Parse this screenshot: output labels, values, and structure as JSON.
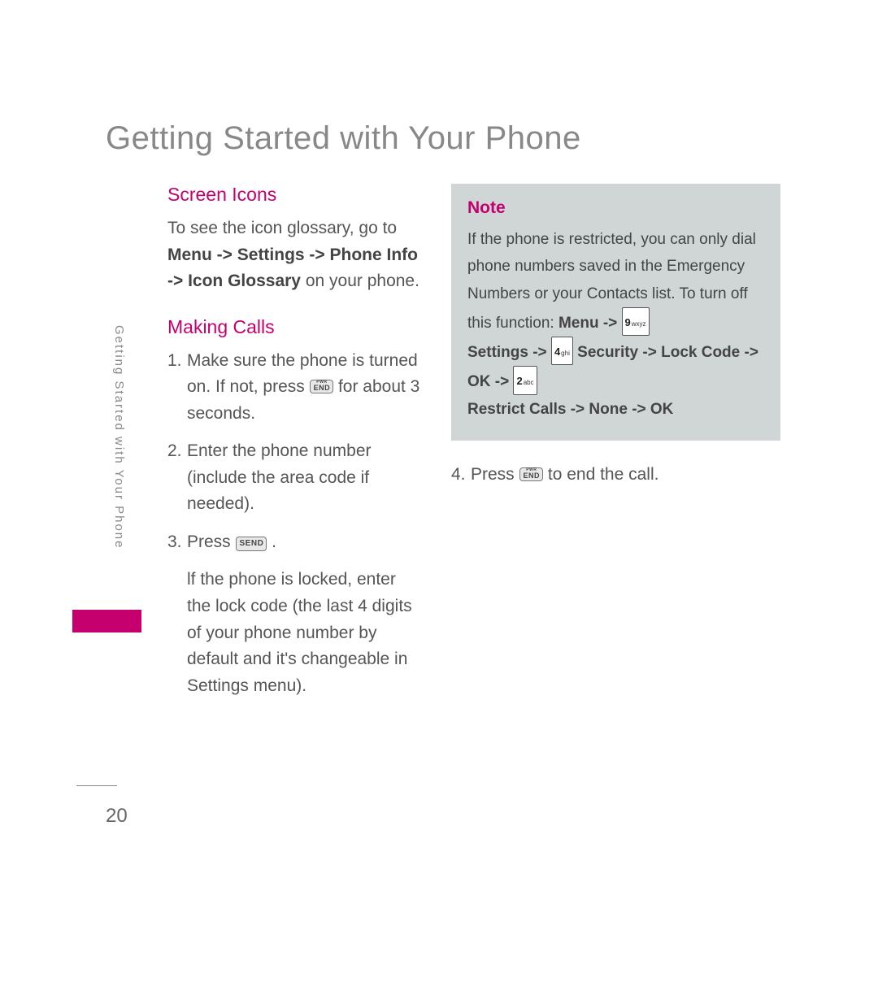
{
  "title": "Getting Started with Your Phone",
  "side_tab": "Getting Started with Your Phone",
  "page_number": "20",
  "left": {
    "screen_icons": {
      "heading": "Screen Icons",
      "line1": "To see the icon glossary, go to ",
      "bold1": "Menu -> Settings -> Phone Info -> Icon Glossary",
      "line2": " on your phone."
    },
    "making_calls": {
      "heading": "Making Calls",
      "items": [
        {
          "num": "1.",
          "pre": "Make sure the phone is turned on. If not, press ",
          "key": "PWR END",
          "post": " for about 3 seconds."
        },
        {
          "num": "2.",
          "text": "Enter the phone number (include the area code if needed)."
        },
        {
          "num": "3.",
          "pre": "Press ",
          "key": "SEND",
          "post": " .",
          "extra": "lf the phone is locked, enter the lock code (the last 4 digits of your phone number by default and it's changeable in Settings menu)."
        }
      ]
    }
  },
  "right": {
    "note": {
      "heading": "Note",
      "line1": "If the phone is restricted, you can only dial phone numbers saved in the Emergency Numbers or your Contacts list. To turn off this function: ",
      "menu_bold": "Menu ->",
      "key9": {
        "big": "9",
        "small": "wxyz"
      },
      "settings_bold": "Settings ->",
      "key4": {
        "big": "4",
        "small": "ghi"
      },
      "security_bold": "Security -> Lock Code -> OK ->",
      "key2": {
        "big": "2",
        "small": "abc"
      },
      "tail_bold": "Restrict Calls -> None -> OK"
    },
    "step4": {
      "num": "4.",
      "pre": "Press ",
      "key": "PWR END",
      "post": " to end the call."
    }
  }
}
